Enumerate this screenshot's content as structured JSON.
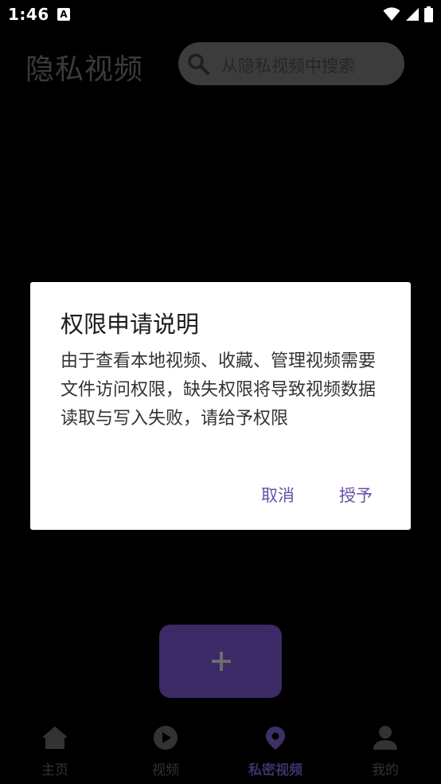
{
  "status_bar": {
    "time": "1:46",
    "notification_letter": "A"
  },
  "header": {
    "title": "隐私视频",
    "search_placeholder": "从隐私视频中搜索"
  },
  "dialog": {
    "title": "权限申请说明",
    "message": "由于查看本地视频、收藏、管理视频需要文件访问权限，缺失权限将导致视频数据读取与写入失败，请给予权限",
    "cancel_label": "取消",
    "grant_label": "授予"
  },
  "fab": {
    "icon": "plus-icon"
  },
  "bottom_nav": {
    "active_index": 2,
    "items": [
      {
        "label": "主页",
        "icon": "home-icon"
      },
      {
        "label": "视频",
        "icon": "play-icon"
      },
      {
        "label": "私密视频",
        "icon": "location-pin-icon"
      },
      {
        "label": "我的",
        "icon": "person-icon"
      }
    ]
  },
  "colors": {
    "accent": "#6950a8",
    "fab": "#3b2a66",
    "active_nav": "#3e2f69"
  }
}
